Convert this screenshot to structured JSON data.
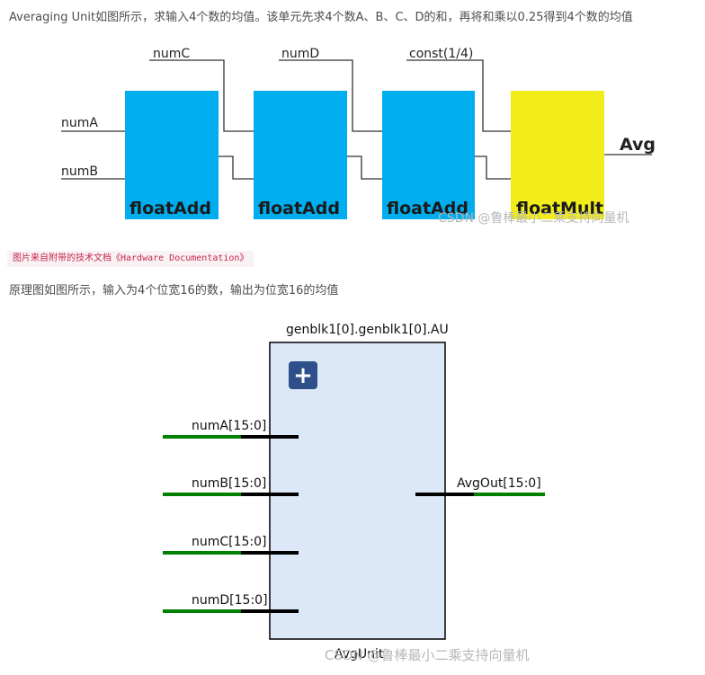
{
  "intro_text": "Averaging Unit如图所示，求输入4个数的均值。该单元先求4个数A、B、C、D的和，再将和乘以0.25得到4个数的均值",
  "diagram1": {
    "blocks": [
      "floatAdd",
      "floatAdd",
      "floatAdd",
      "floatMult"
    ],
    "inputs": {
      "a": "numA",
      "b": "numB",
      "c": "numC",
      "d": "numD",
      "const": "const(1/4)"
    },
    "output": "Avg",
    "colors": {
      "add_block": "#00aeef",
      "mult_block": "#f2ec1b"
    }
  },
  "watermark": "CSDN @鲁棒最小二乘支持向量机",
  "caption": "图片来自附带的技术文档《Hardware Documentation》",
  "desc_text": "原理图如图所示，输入为4个位宽16的数，输出为位宽16的均值",
  "diagram2": {
    "instance_name": "genblk1[0].genblk1[0].AU",
    "module_name": "AvgUnit",
    "expand_glyph": "+",
    "ports_in": [
      "numA[15:0]",
      "numB[15:0]",
      "numC[15:0]",
      "numD[15:0]"
    ],
    "port_out": "AvgOut[15:0]",
    "colors": {
      "module_fill": "#dce8f8",
      "wire": "#008000",
      "pin": "#000000",
      "expand_button": "#2f4f8a"
    }
  }
}
